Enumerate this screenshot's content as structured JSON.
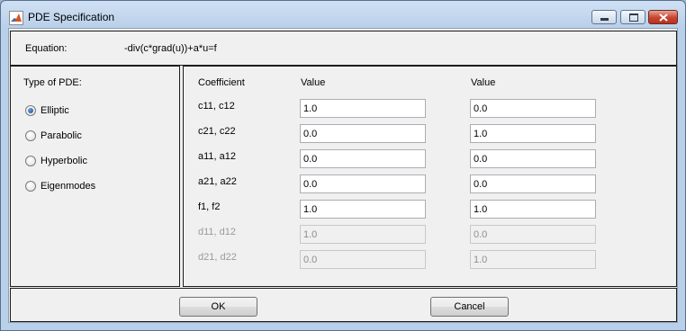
{
  "window": {
    "title": "PDE Specification"
  },
  "equation": {
    "label": "Equation:",
    "value": "-div(c*grad(u))+a*u=f"
  },
  "pde_type": {
    "label": "Type of PDE:",
    "options": [
      {
        "label": "Elliptic",
        "selected": true
      },
      {
        "label": "Parabolic",
        "selected": false
      },
      {
        "label": "Hyperbolic",
        "selected": false
      },
      {
        "label": "Eigenmodes",
        "selected": false
      }
    ]
  },
  "coefficients": {
    "headers": [
      "Coefficient",
      "Value",
      "Value"
    ],
    "rows": [
      {
        "name": "c11, c12",
        "v1": "1.0",
        "v2": "0.0",
        "enabled": true
      },
      {
        "name": "c21, c22",
        "v1": "0.0",
        "v2": "1.0",
        "enabled": true
      },
      {
        "name": "a11, a12",
        "v1": "0.0",
        "v2": "0.0",
        "enabled": true
      },
      {
        "name": "a21, a22",
        "v1": "0.0",
        "v2": "0.0",
        "enabled": true
      },
      {
        "name": "f1, f2",
        "v1": "1.0",
        "v2": "1.0",
        "enabled": true
      },
      {
        "name": "d11, d12",
        "v1": "1.0",
        "v2": "0.0",
        "enabled": false
      },
      {
        "name": "d21, d22",
        "v1": "0.0",
        "v2": "1.0",
        "enabled": false
      }
    ]
  },
  "buttons": {
    "ok": "OK",
    "cancel": "Cancel"
  }
}
